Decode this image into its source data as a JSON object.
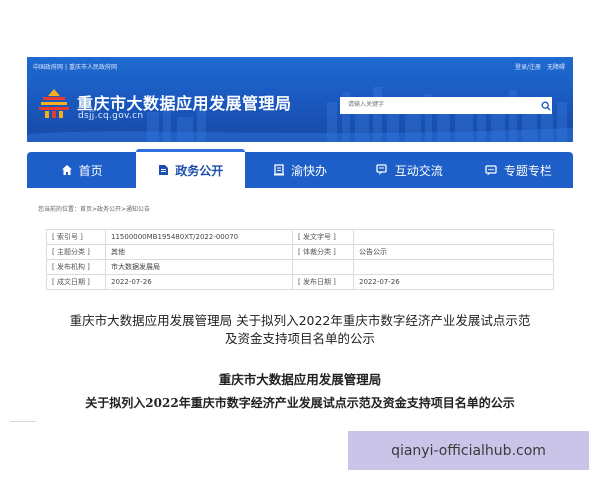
{
  "header": {
    "top_links": [
      "中国政府网",
      "|",
      "重庆市人民政府网"
    ],
    "account_links": [
      "登录/注册",
      "无障碍"
    ],
    "site_title": "重庆市大数据应用发展管理局",
    "site_domain": "dsjj.cq.gov.cn",
    "search": {
      "placeholder": "请输入关键字"
    },
    "colors": {
      "header_blue": "#1a57bd",
      "nav_blue": "#1d5ec8",
      "logo_red": "#e63a2a",
      "logo_gold": "#f2b01e"
    }
  },
  "nav": {
    "items": [
      {
        "label": "首页",
        "icon": "home-icon"
      },
      {
        "label": "政务公开",
        "icon": "document-icon",
        "active": true
      },
      {
        "label": "渝快办",
        "icon": "service-icon"
      },
      {
        "label": "互动交流",
        "icon": "chat-icon"
      },
      {
        "label": "专题专栏",
        "icon": "topic-icon"
      }
    ]
  },
  "breadcrumb": "您当前的位置：首页>政务公开>通知公告",
  "info_table": {
    "rows": [
      {
        "l1": "[ 索引号 ]",
        "v1": "11500000MB195480XT/2022-00070",
        "l2": "[ 发文字号 ]",
        "v2": ""
      },
      {
        "l1": "[ 主题分类 ]",
        "v1": "其他",
        "l2": "[ 体裁分类 ]",
        "v2": "公告公示"
      },
      {
        "l1": "[ 发布机构 ]",
        "v1": "市大数据发展局",
        "l2": "",
        "v2": ""
      },
      {
        "l1": "[ 成文日期 ]",
        "v1": "2022-07-26",
        "l2": "[ 发布日期 ]",
        "v2": "2022-07-26"
      }
    ]
  },
  "document": {
    "title_line1": "重庆市大数据应用发展管理局 关于拟列入2022年重庆市数字经济产业发展试点示范",
    "title_line2": "及资金支持项目名单的公示",
    "body_org": "重庆市大数据应用发展管理局",
    "body_subtitle": "关于拟列入2022年重庆市数字经济产业发展试点示范及资金支持项目名单的公示"
  },
  "watermark": "qianyi-officialhub.com"
}
